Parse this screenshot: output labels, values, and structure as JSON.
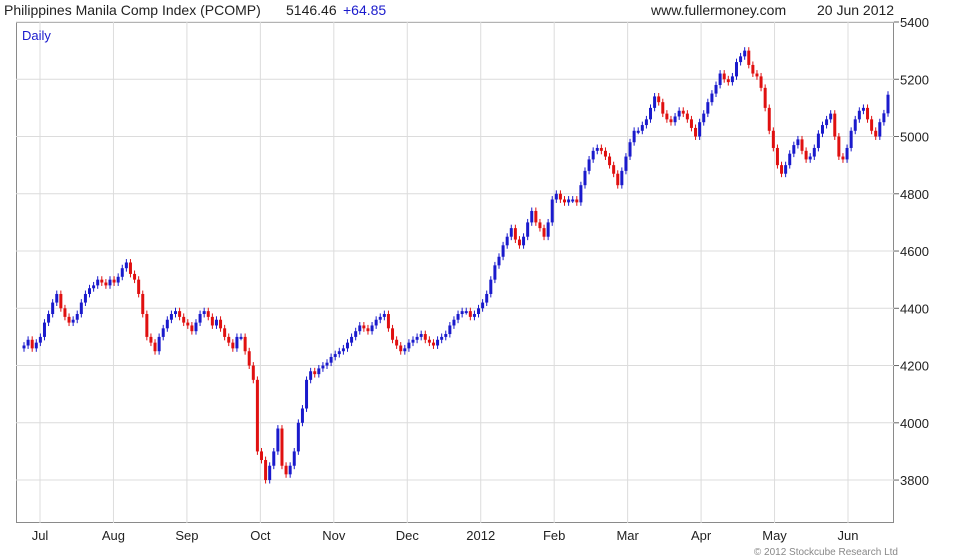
{
  "header": {
    "title": "Philippines Manila Comp Index (PCOMP)",
    "last": "5146.46",
    "change": "+64.85",
    "site": "www.fullermoney.com",
    "date": "20 Jun 2012"
  },
  "colors": {
    "up": "#1a1acc",
    "down": "#e01010",
    "grid": "#dcdcdc"
  },
  "footer": {
    "copyright": "© 2012 Stockcube Research Ltd"
  },
  "chart_data": {
    "type": "candlestick",
    "period_label": "Daily",
    "grid": true,
    "y_axis_position": "right",
    "ylim": [
      3650,
      5400
    ],
    "y_ticks": [
      3800,
      4000,
      4200,
      4400,
      4600,
      4800,
      5000,
      5200,
      5400
    ],
    "x_ticks": [
      "Jul",
      "Aug",
      "Sep",
      "Oct",
      "Nov",
      "Dec",
      "2012",
      "Feb",
      "Mar",
      "Apr",
      "May",
      "Jun"
    ],
    "closes": [
      4270,
      4290,
      4260,
      4280,
      4300,
      4350,
      4380,
      4420,
      4450,
      4400,
      4370,
      4350,
      4360,
      4380,
      4420,
      4450,
      4470,
      4480,
      4500,
      4490,
      4480,
      4500,
      4490,
      4510,
      4540,
      4560,
      4520,
      4500,
      4450,
      4380,
      4300,
      4280,
      4250,
      4300,
      4330,
      4360,
      4380,
      4390,
      4370,
      4350,
      4340,
      4320,
      4350,
      4380,
      4390,
      4370,
      4340,
      4360,
      4330,
      4300,
      4280,
      4260,
      4300,
      4300,
      4250,
      4200,
      4150,
      3900,
      3870,
      3800,
      3850,
      3900,
      3980,
      3850,
      3820,
      3850,
      3900,
      4000,
      4050,
      4150,
      4180,
      4170,
      4190,
      4200,
      4210,
      4230,
      4240,
      4250,
      4260,
      4280,
      4300,
      4320,
      4340,
      4330,
      4320,
      4340,
      4360,
      4370,
      4380,
      4330,
      4290,
      4270,
      4250,
      4260,
      4280,
      4290,
      4300,
      4310,
      4290,
      4280,
      4270,
      4290,
      4300,
      4310,
      4340,
      4360,
      4380,
      4390,
      4390,
      4370,
      4380,
      4400,
      4420,
      4450,
      4500,
      4550,
      4580,
      4620,
      4650,
      4680,
      4640,
      4620,
      4650,
      4700,
      4740,
      4700,
      4680,
      4650,
      4700,
      4780,
      4800,
      4780,
      4770,
      4780,
      4780,
      4770,
      4830,
      4880,
      4920,
      4950,
      4960,
      4950,
      4930,
      4900,
      4870,
      4830,
      4880,
      4930,
      4980,
      5020,
      5020,
      5040,
      5060,
      5100,
      5140,
      5120,
      5080,
      5060,
      5050,
      5070,
      5090,
      5080,
      5060,
      5030,
      5000,
      5050,
      5080,
      5120,
      5150,
      5180,
      5220,
      5200,
      5190,
      5210,
      5260,
      5280,
      5300,
      5250,
      5220,
      5210,
      5170,
      5100,
      5020,
      4960,
      4900,
      4870,
      4900,
      4940,
      4970,
      4990,
      4950,
      4920,
      4930,
      4960,
      5010,
      5040,
      5060,
      5080,
      5000,
      4930,
      4920,
      4960,
      5020,
      5060,
      5090,
      5100,
      5060,
      5020,
      5000,
      5050,
      5081,
      5146
    ]
  }
}
